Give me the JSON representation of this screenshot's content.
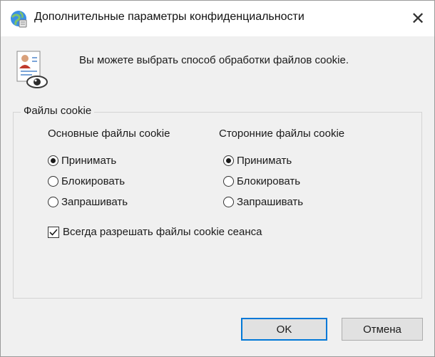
{
  "window": {
    "title": "Дополнительные параметры конфиденциальности",
    "close_glyph": "✕"
  },
  "header": {
    "text": "Вы можете выбрать способ обработки файлов cookie."
  },
  "cookies_group": {
    "legend": "Файлы cookie",
    "first_party": {
      "heading": "Основные файлы cookie",
      "options": [
        "Принимать",
        "Блокировать",
        "Запрашивать"
      ],
      "selected": "Принимать"
    },
    "third_party": {
      "heading": "Сторонние файлы cookie",
      "options": [
        "Принимать",
        "Блокировать",
        "Запрашивать"
      ],
      "selected": "Принимать"
    },
    "session_checkbox": {
      "label": "Всегда разрешать файлы cookie сеанса",
      "checked": true
    }
  },
  "buttons": {
    "ok": "OK",
    "cancel": "Отмена"
  }
}
